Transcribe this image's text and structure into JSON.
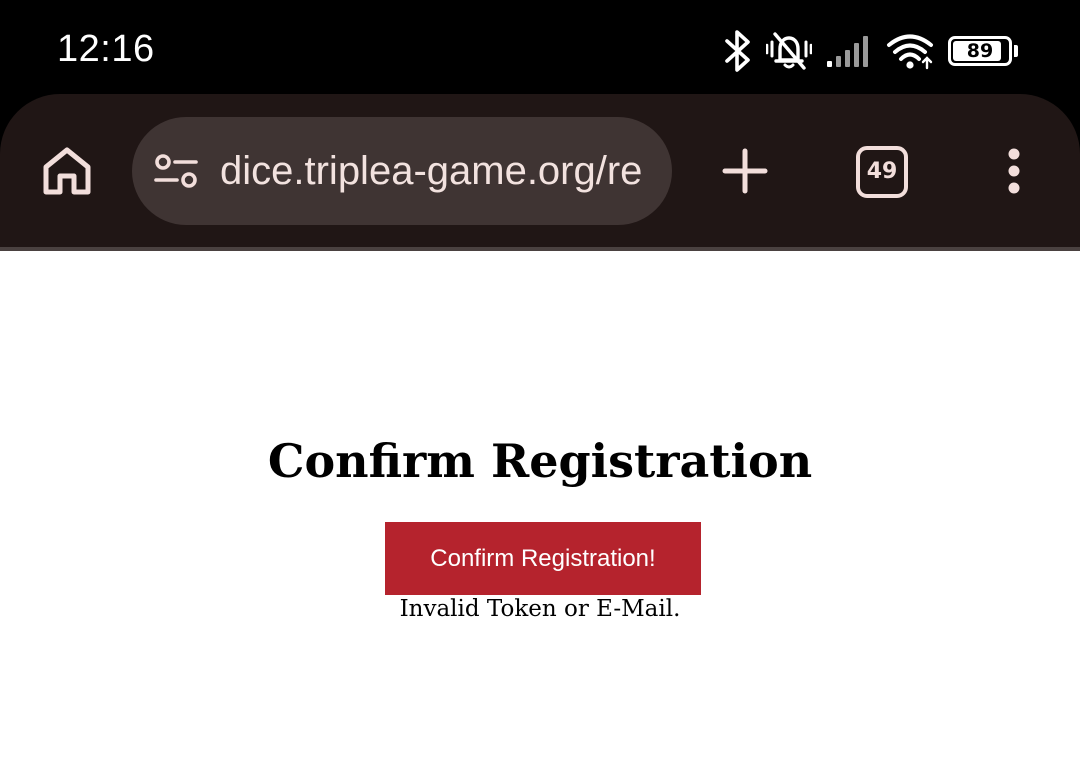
{
  "status_bar": {
    "time": "12:16",
    "battery_level": "89",
    "battery_fraction": 0.89,
    "icons": [
      "bluetooth-icon",
      "vibrate-silent-icon",
      "cellular-signal-icon",
      "wifi-icon",
      "battery-icon"
    ]
  },
  "browser": {
    "url": "dice.triplea-game.org/re",
    "tab_count": "49",
    "icons": {
      "home": "home-icon",
      "site_settings": "site-settings-icon",
      "new_tab": "plus-icon",
      "menu": "more-vert-icon"
    },
    "colors": {
      "toolbar": "#201615",
      "address_bar": "#3f3433",
      "icon": "#f2dedb"
    }
  },
  "page": {
    "heading": "Confirm Registration",
    "confirm_button_label": "Confirm Registration!",
    "error_message": "Invalid Token or E-Mail.",
    "colors": {
      "button": "#b5232d",
      "button_text": "#ffffff",
      "background": "#ffffff"
    }
  }
}
